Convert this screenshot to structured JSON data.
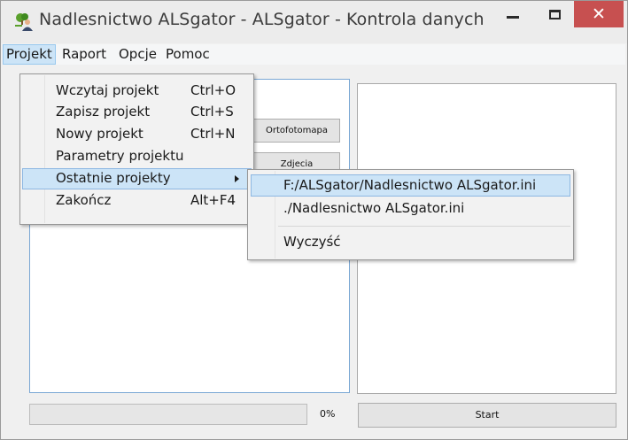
{
  "window": {
    "title": "Nadlesnictwo ALSgator - ALSgator - Kontrola danych",
    "close_glyph": "✕",
    "icons": {
      "app": "tree-person-icon",
      "minimize": "minimize-icon",
      "maximize": "maximize-icon",
      "close": "close-icon"
    },
    "colors": {
      "close_button": "#c75050",
      "highlight": "#cce4f7",
      "menu_border": "#99c9ef"
    }
  },
  "menubar": {
    "items": [
      {
        "label": "Projekt",
        "active": true
      },
      {
        "label": "Raport"
      },
      {
        "label": "Opcje"
      },
      {
        "label": "Pomoc"
      }
    ]
  },
  "projekt_menu": {
    "items": [
      {
        "label": "Wczytaj projekt",
        "shortcut": "Ctrl+O"
      },
      {
        "label": "Zapisz projekt",
        "shortcut": "Ctrl+S"
      },
      {
        "label": "Nowy projekt",
        "shortcut": "Ctrl+N"
      },
      {
        "label": "Parametry projektu",
        "shortcut": ""
      },
      {
        "label": "Ostatnie projekty",
        "shortcut": "",
        "submenu": true,
        "highlighted": true
      },
      {
        "label": "Zakończ",
        "shortcut": "Alt+F4"
      }
    ]
  },
  "recent_submenu": {
    "items": [
      {
        "label": "F:/ALSgator/Nadlesnictwo ALSgator.ini",
        "highlighted": true
      },
      {
        "label": "./Nadlesnictwo ALSgator.ini"
      },
      {
        "label": "Wyczyść"
      }
    ]
  },
  "main": {
    "ortofotomapa_label": "Ortofotomapa",
    "zdjecia_label": "Zdjecia",
    "progress_text": "0%",
    "progress_value": 0,
    "start_label": "Start"
  }
}
